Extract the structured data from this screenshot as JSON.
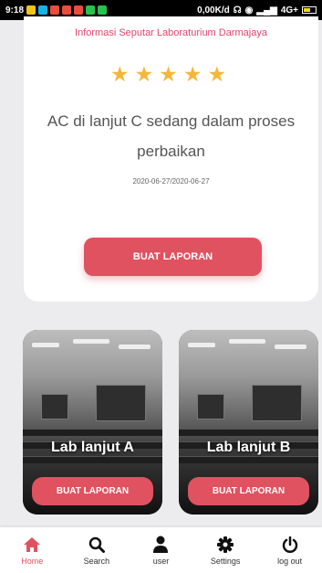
{
  "status_bar": {
    "time": "9:18",
    "network_speed": "0,00K/d",
    "network_type": "4G+",
    "battery_level": 0.6,
    "app_icon_colors": [
      "#f0c419",
      "#16b3e6",
      "#e94e3c",
      "#e94e3c",
      "#e94e3c",
      "#27c24c",
      "#27c24c"
    ]
  },
  "main_card": {
    "subtitle": "Informasi Seputar Laboraturium Darmajaya",
    "rating": 5,
    "message": "AC di lanjut C sedang dalam proses perbaikan",
    "date": "2020-06-27/2020-06-27",
    "button_label": "BUAT LAPORAN"
  },
  "lab_cards": [
    {
      "title": "Lab lanjut A",
      "button_label": "BUAT LAPORAN"
    },
    {
      "title": "Lab lanjut B",
      "button_label": "BUAT LAPORAN"
    }
  ],
  "bottom_nav": {
    "items": [
      {
        "label": "Home",
        "icon": "home-icon",
        "active": true
      },
      {
        "label": "Search",
        "icon": "search-icon",
        "active": false
      },
      {
        "label": "user",
        "icon": "user-icon",
        "active": false
      },
      {
        "label": "Settings",
        "icon": "gear-icon",
        "active": false
      },
      {
        "label": "log out",
        "icon": "power-icon",
        "active": false
      }
    ]
  },
  "colors": {
    "accent": "#e05260",
    "subtitle": "#e0466d",
    "star": "#f4b73a",
    "background": "#ececef"
  }
}
